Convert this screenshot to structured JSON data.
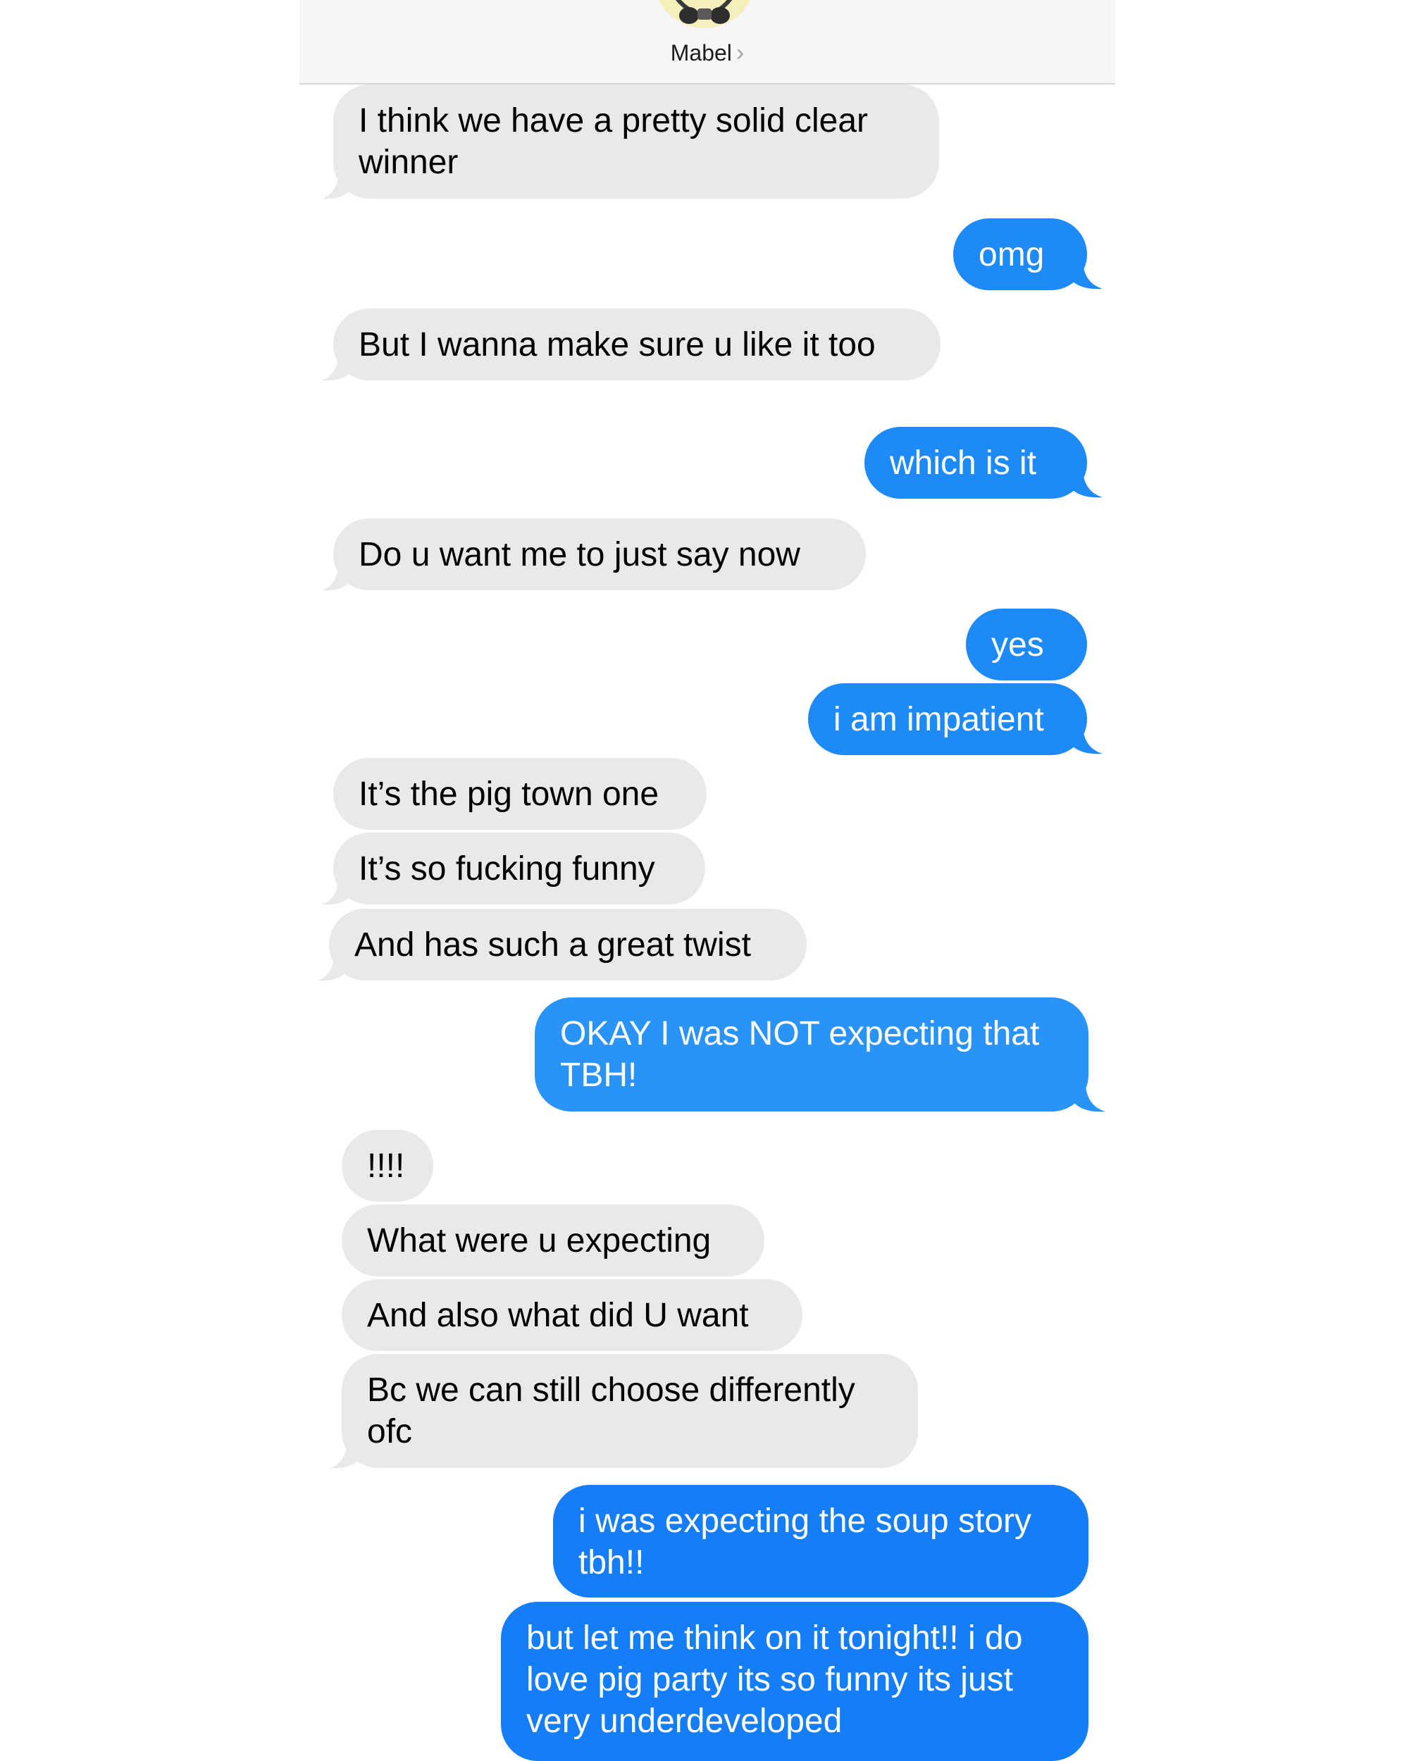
{
  "contact": {
    "name": "Mabel",
    "chevron": "›",
    "avatar_icon": "memoji-avatar-icon"
  },
  "colors": {
    "incoming": "#e9e9eb",
    "outgoing": "#1d8af8",
    "header_bg": "#f6f6f6"
  },
  "messages": [
    {
      "from": "them",
      "text": "I think we have a pretty solid clear\nwinner"
    },
    {
      "from": "me",
      "text": "omg"
    },
    {
      "from": "them",
      "text": "But I wanna make sure u like it too"
    },
    {
      "from": "me",
      "text": "which is it"
    },
    {
      "from": "them",
      "text": "Do u want me to just say now"
    },
    {
      "from": "me",
      "text": "yes"
    },
    {
      "from": "me",
      "text": "i am impatient"
    },
    {
      "from": "them",
      "text": "It’s the pig town one"
    },
    {
      "from": "them",
      "text": "It’s so fucking funny"
    },
    {
      "from": "them",
      "text": "And has such a great twist"
    },
    {
      "from": "me",
      "text": "OKAY I was NOT expecting that\nTBH!"
    },
    {
      "from": "them",
      "text": "!!!!"
    },
    {
      "from": "them",
      "text": "What were u expecting"
    },
    {
      "from": "them",
      "text": "And also what did U want"
    },
    {
      "from": "them",
      "text": "Bc we can still choose differently\nofc"
    },
    {
      "from": "me",
      "text": "i was expecting the soup story\ntbh!!"
    },
    {
      "from": "me",
      "text": "but let me think on it tonight!! i do\nlove pig party its so funny its just\nvery underdeveloped"
    }
  ]
}
